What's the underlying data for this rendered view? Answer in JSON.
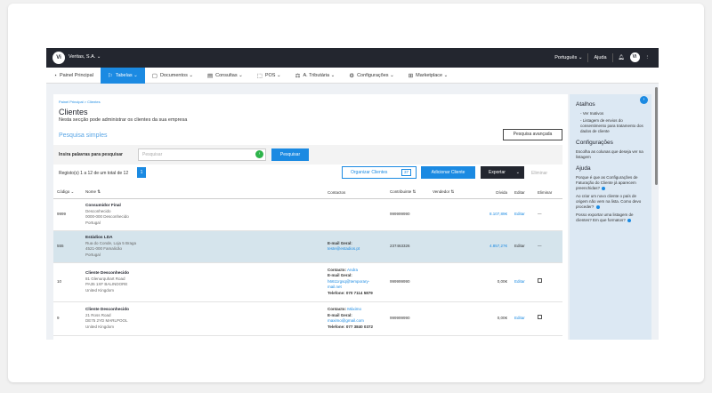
{
  "topbar": {
    "logo": "Vi",
    "company": "Veritas, S.A. ⌄",
    "language": "Português ⌄",
    "help": "Ajuda",
    "avatar": "Vi"
  },
  "nav": [
    {
      "label": "Painel Principal",
      "icon": "◔"
    },
    {
      "label": "Tabelas ⌄",
      "icon": "⚐"
    },
    {
      "label": "Documentos ⌄",
      "icon": "▢"
    },
    {
      "label": "Consultas ⌄",
      "icon": "▤"
    },
    {
      "label": "POS ⌄",
      "icon": "⬚"
    },
    {
      "label": "A. Tributária ⌄",
      "icon": "⚖"
    },
    {
      "label": "Configurações ⌄",
      "icon": "⚙"
    },
    {
      "label": "Marketplace ⌄",
      "icon": "⊞"
    }
  ],
  "page": {
    "breadcrumb": "Painel Principal  >  Clientes",
    "title": "Clientes",
    "subtitle": "Nesta secção pode administrar os clientes da sua empresa",
    "simple_search": "Pesquisa simples",
    "advanced_search": "Pesquisa avançada",
    "search_label": "Insira palavras para pesquisar",
    "search_placeholder": "Pesquisar",
    "search_button": "Pesquisar",
    "records": "Registo(s) 1 a 12 de um total de 12",
    "page_number": "1",
    "organize_button": "Organizar Clientes",
    "organize_count": "37",
    "add_button": "Adicionar Cliente",
    "export_button": "Exportar",
    "delete_button": "Eliminar"
  },
  "table": {
    "headers": {
      "code": "Código ⌄",
      "name": "Nome ⇅",
      "contacts": "Contactos",
      "nif": "Contribuinte ⇅",
      "seller": "Vendedor ⇅",
      "debt": "Dívida",
      "edit": "Editar",
      "delete": "Eliminar"
    },
    "rows": [
      {
        "code": "9999",
        "name": "Consumidor Final",
        "addr1": "Desconhecido",
        "addr2": "0000-000 Desconhecido",
        "addr3": "Portugal",
        "contact_label": "",
        "contact_value": "",
        "email_label": "",
        "email_value": "",
        "phone": "",
        "nif": "999999990",
        "debt": "8.107,89€",
        "debt_link": true,
        "edit": "Editar",
        "action": "—"
      },
      {
        "code": "555",
        "name": "Estádios LDA",
        "addr1": "Rua do Conde, Loja 5 Braga",
        "addr2": "4521-000 Famalicão",
        "addr3": "Portugal",
        "contact_label": "",
        "contact_value": "",
        "email_label": "E-mail Geral:",
        "email_value": "teste@estadios.pt",
        "phone": "",
        "nif": "237463326",
        "debt": "4.857,27€",
        "debt_link": true,
        "edit": "Editar",
        "action": "—"
      },
      {
        "code": "10",
        "name": "Cliente Desconhecido",
        "addr1": "81 Glenurquhart Road",
        "addr2": "PA35 1XF BALINDORE",
        "addr3": "United Kingdom",
        "contact_label": "Contacto:",
        "contact_value": "Andra",
        "email_label": "E-mail Geral:",
        "email_value": "h6611rgsq@temporary-mail.net",
        "phone": "Telefone: 070 7114 5879",
        "nif": "999999990",
        "debt": "0,00€",
        "debt_link": false,
        "edit": "Editar",
        "action": "checkbox"
      },
      {
        "code": "9",
        "name": "Cliente Desconhecido",
        "addr1": "21 Ross Road",
        "addr2": "DE75 2YD MARLPOOL",
        "addr3": "United Kingdom",
        "contact_label": "Contacto:",
        "contact_value": "Máximo",
        "email_label": "E-mail Geral:",
        "email_value": "maximo@gmail.com",
        "phone": "Telefone: 077 3840 0372",
        "nif": "999999990",
        "debt": "0,00€",
        "debt_link": false,
        "edit": "Editar",
        "action": "checkbox"
      }
    ]
  },
  "sidebar": {
    "toggle": "›",
    "shortcuts_title": "Atalhos",
    "shortcuts": [
      "- Ver Inativos",
      "- Listagem de envios do consentimento para tratamento dos dados de cliente"
    ],
    "config_title": "Configurações",
    "config_text": "Escolha as colunas que deseja ver na listagem",
    "help_title": "Ajuda",
    "help_items": [
      "Porque é que as Configurações de Faturação do Cliente já aparecem preenchidas?",
      "Ao criar um novo cliente o país de origem não vem na lista. Como devo proceder?",
      "Posso exportar uma listagem de clientes? Em que formatos?"
    ]
  },
  "colors": {
    "accent": "#1b8ae2",
    "topbar": "#23262f",
    "highlight_row": "#d5e4ec",
    "sidebar": "#dce8f3",
    "search_go": "#2db34a"
  }
}
